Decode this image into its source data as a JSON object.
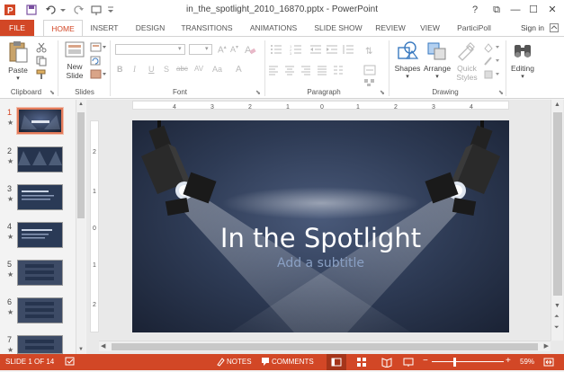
{
  "window": {
    "title": "in_the_spotlight_2010_16870.pptx - PowerPoint",
    "help": "?",
    "restore_ribbon": "⧉",
    "minimize": "—",
    "maximize": "☐",
    "close": "✕"
  },
  "tabs": {
    "file": "FILE",
    "items": [
      "HOME",
      "INSERT",
      "DESIGN",
      "TRANSITIONS",
      "ANIMATIONS",
      "SLIDE SHOW",
      "REVIEW",
      "VIEW",
      "ParticiPoll"
    ],
    "active": "HOME",
    "sign_in": "Sign in"
  },
  "ribbon": {
    "clipboard": {
      "label": "Clipboard",
      "paste": "Paste"
    },
    "slides": {
      "label": "Slides",
      "new_slide_line1": "New",
      "new_slide_line2": "Slide"
    },
    "font": {
      "label": "Font",
      "bold": "B",
      "italic": "I",
      "underline": "U",
      "strike": "S",
      "shadow": "abc",
      "spacing": "AV",
      "case": "Aa",
      "clear": "A"
    },
    "paragraph": {
      "label": "Paragraph"
    },
    "drawing": {
      "label": "Drawing",
      "shapes": "Shapes",
      "arrange": "Arrange",
      "quick_styles_1": "Quick",
      "quick_styles_2": "Styles"
    },
    "editing": {
      "label": "Editing"
    }
  },
  "thumbnails": {
    "numbers": [
      "1",
      "2",
      "3",
      "4",
      "5",
      "6",
      "7"
    ],
    "star": "★",
    "selected": "1"
  },
  "ruler": {
    "ticks": [
      "4",
      "3",
      "2",
      "1",
      "0",
      "1",
      "2",
      "3",
      "4"
    ],
    "vticks": [
      "2",
      "1",
      "0",
      "1",
      "2"
    ]
  },
  "slide": {
    "title": "In the Spotlight",
    "subtitle": "Add a subtitle"
  },
  "status": {
    "slide_of": "SLIDE 1 OF 14",
    "notes": "NOTES",
    "comments": "COMMENTS",
    "zoom": "59%",
    "zoom_minus": "−",
    "zoom_plus": "+"
  },
  "colors": {
    "accent": "#d24726",
    "slide_bg": "#2e3b55"
  }
}
